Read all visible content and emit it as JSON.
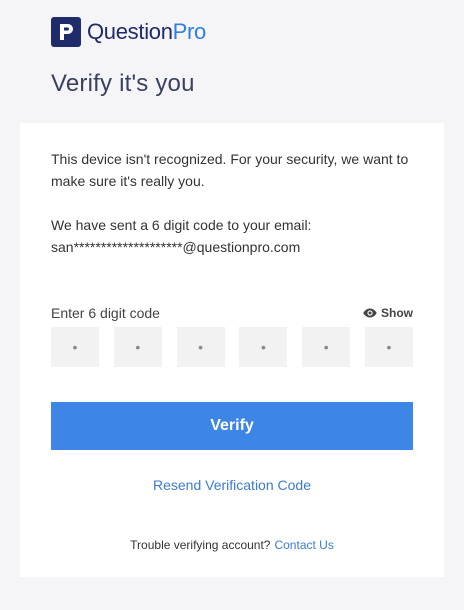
{
  "brand": {
    "name_part1": "Question",
    "name_part2": "Pro",
    "primary_color": "#1f2b6b",
    "accent_color": "#2f7ee6"
  },
  "page_title": "Verify it's you",
  "messages": {
    "device_notice": "This device isn't recognized. For your security, we want to make sure it's really you.",
    "code_sent_line1": "We have sent a 6 digit code to your email:",
    "masked_email": "san********************@questionpro.com"
  },
  "code_entry": {
    "label": "Enter 6 digit code",
    "show_label": "Show",
    "show_icon": "eye-icon",
    "boxes": [
      {
        "placeholder": "•"
      },
      {
        "placeholder": "•"
      },
      {
        "placeholder": "•"
      },
      {
        "placeholder": "•"
      },
      {
        "placeholder": "•"
      },
      {
        "placeholder": "•"
      }
    ]
  },
  "actions": {
    "verify_label": "Verify",
    "verify_color": "#3d86e5",
    "resend_label": "Resend Verification Code",
    "trouble_text": "Trouble verifying account?",
    "contact_label": "Contact Us"
  }
}
